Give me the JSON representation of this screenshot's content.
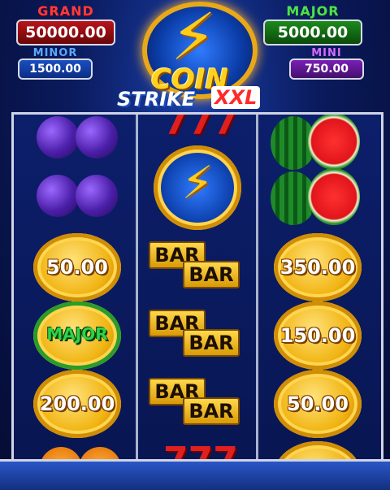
{
  "jackpots": {
    "grand": {
      "label": "GRAND",
      "value": "50000.00"
    },
    "major": {
      "label": "MAJOR",
      "value": "5000.00"
    },
    "minor": {
      "label": "MINOR",
      "value": "1500.00"
    },
    "mini": {
      "label": "MINI",
      "value": "750.00"
    }
  },
  "logo": {
    "line1": "COIN",
    "line2": "STRIKE",
    "badge": "XXL"
  },
  "reels": {
    "reel1": {
      "coin1": "50.00",
      "coin2": "MAJOR",
      "coin3": "200.00"
    },
    "reel2": {
      "bar": "BAR",
      "sevens": "777"
    },
    "reel3": {
      "coin1": "350.00",
      "coin2": "150.00",
      "coin3": "50.00"
    }
  },
  "colors": {
    "grand": "#b8141a",
    "major": "#1c8a1c",
    "minor": "#1a4fc2",
    "mini": "#7a1fb8",
    "coin_gold": "#f1b514"
  },
  "icons": [
    "lightning-bolt-icon",
    "plum-icon",
    "watermelon-icon",
    "bar-icon",
    "seven-icon",
    "coin-icon"
  ]
}
